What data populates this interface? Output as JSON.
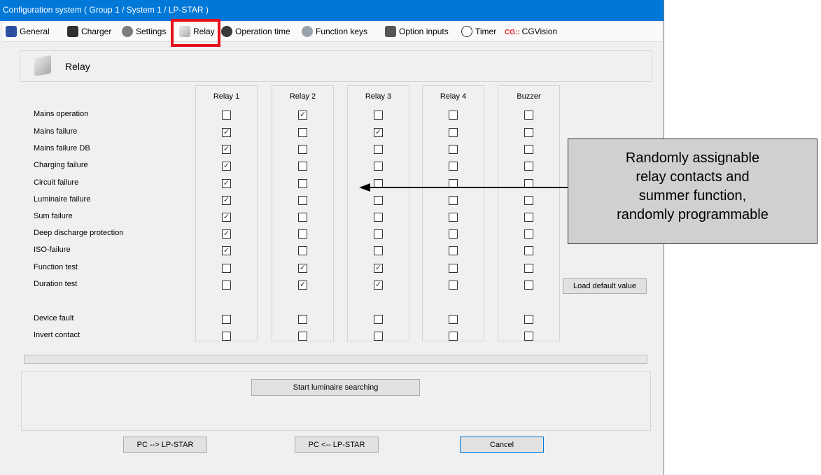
{
  "window": {
    "title": "Configuration system ( Group 1 / System 1 / LP-STAR )"
  },
  "toolbar": {
    "items": [
      {
        "label": "General",
        "icon": "general-icon"
      },
      {
        "label": "Charger",
        "icon": "charger-icon"
      },
      {
        "label": "Settings",
        "icon": "settings-gear-icon"
      },
      {
        "label": "Relay",
        "icon": "relay-icon",
        "active": true
      },
      {
        "label": "Operation time",
        "icon": "operation-time-icon"
      },
      {
        "label": "Function keys",
        "icon": "function-keys-icon"
      },
      {
        "label": "Option inputs",
        "icon": "option-inputs-icon"
      },
      {
        "label": "Timer",
        "icon": "clock-icon"
      },
      {
        "label": "CGVision",
        "icon": "cgvision-icon",
        "icon_text": "CG::"
      }
    ]
  },
  "section": {
    "title": "Relay"
  },
  "relay_table": {
    "columns": [
      "Relay 1",
      "Relay 2",
      "Relay 3",
      "Relay 4",
      "Buzzer"
    ],
    "rows": [
      {
        "label": "Mains operation",
        "checked": [
          false,
          true,
          false,
          false,
          false
        ]
      },
      {
        "label": "Mains failure",
        "checked": [
          true,
          false,
          true,
          false,
          false
        ]
      },
      {
        "label": "Mains failure DB",
        "checked": [
          true,
          false,
          false,
          false,
          false
        ]
      },
      {
        "label": "Charging failure",
        "checked": [
          true,
          false,
          false,
          false,
          false
        ]
      },
      {
        "label": "Circuit failure",
        "checked": [
          true,
          false,
          false,
          false,
          false
        ]
      },
      {
        "label": "Luminaire failure",
        "checked": [
          true,
          false,
          false,
          false,
          false
        ]
      },
      {
        "label": "Sum failure",
        "checked": [
          true,
          false,
          false,
          false,
          false
        ]
      },
      {
        "label": "Deep discharge protection",
        "checked": [
          true,
          false,
          false,
          false,
          false
        ]
      },
      {
        "label": "ISO-failure",
        "checked": [
          true,
          false,
          false,
          false,
          false
        ]
      },
      {
        "label": "Function test",
        "checked": [
          false,
          true,
          true,
          false,
          false
        ]
      },
      {
        "label": "Duration test",
        "checked": [
          false,
          true,
          true,
          false,
          false
        ]
      },
      {
        "label": "Device fault",
        "checked": [
          false,
          false,
          false,
          false,
          false
        ]
      },
      {
        "label": "Invert contact",
        "checked": [
          false,
          false,
          false,
          false,
          false
        ]
      }
    ]
  },
  "buttons": {
    "load_default": "Load default value",
    "start_search": "Start luminaire searching",
    "pc_to_lp": "PC --> LP-STAR",
    "lp_to_pc": "PC <-- LP-STAR",
    "cancel": "Cancel"
  },
  "callout": {
    "lines": [
      "Randomly assignable",
      "relay contacts and",
      "summer function,",
      "randomly programmable"
    ]
  },
  "colors": {
    "titlebar": "#0078d7",
    "highlight": "#e8101d",
    "callout_bg": "#d0d0d0"
  }
}
